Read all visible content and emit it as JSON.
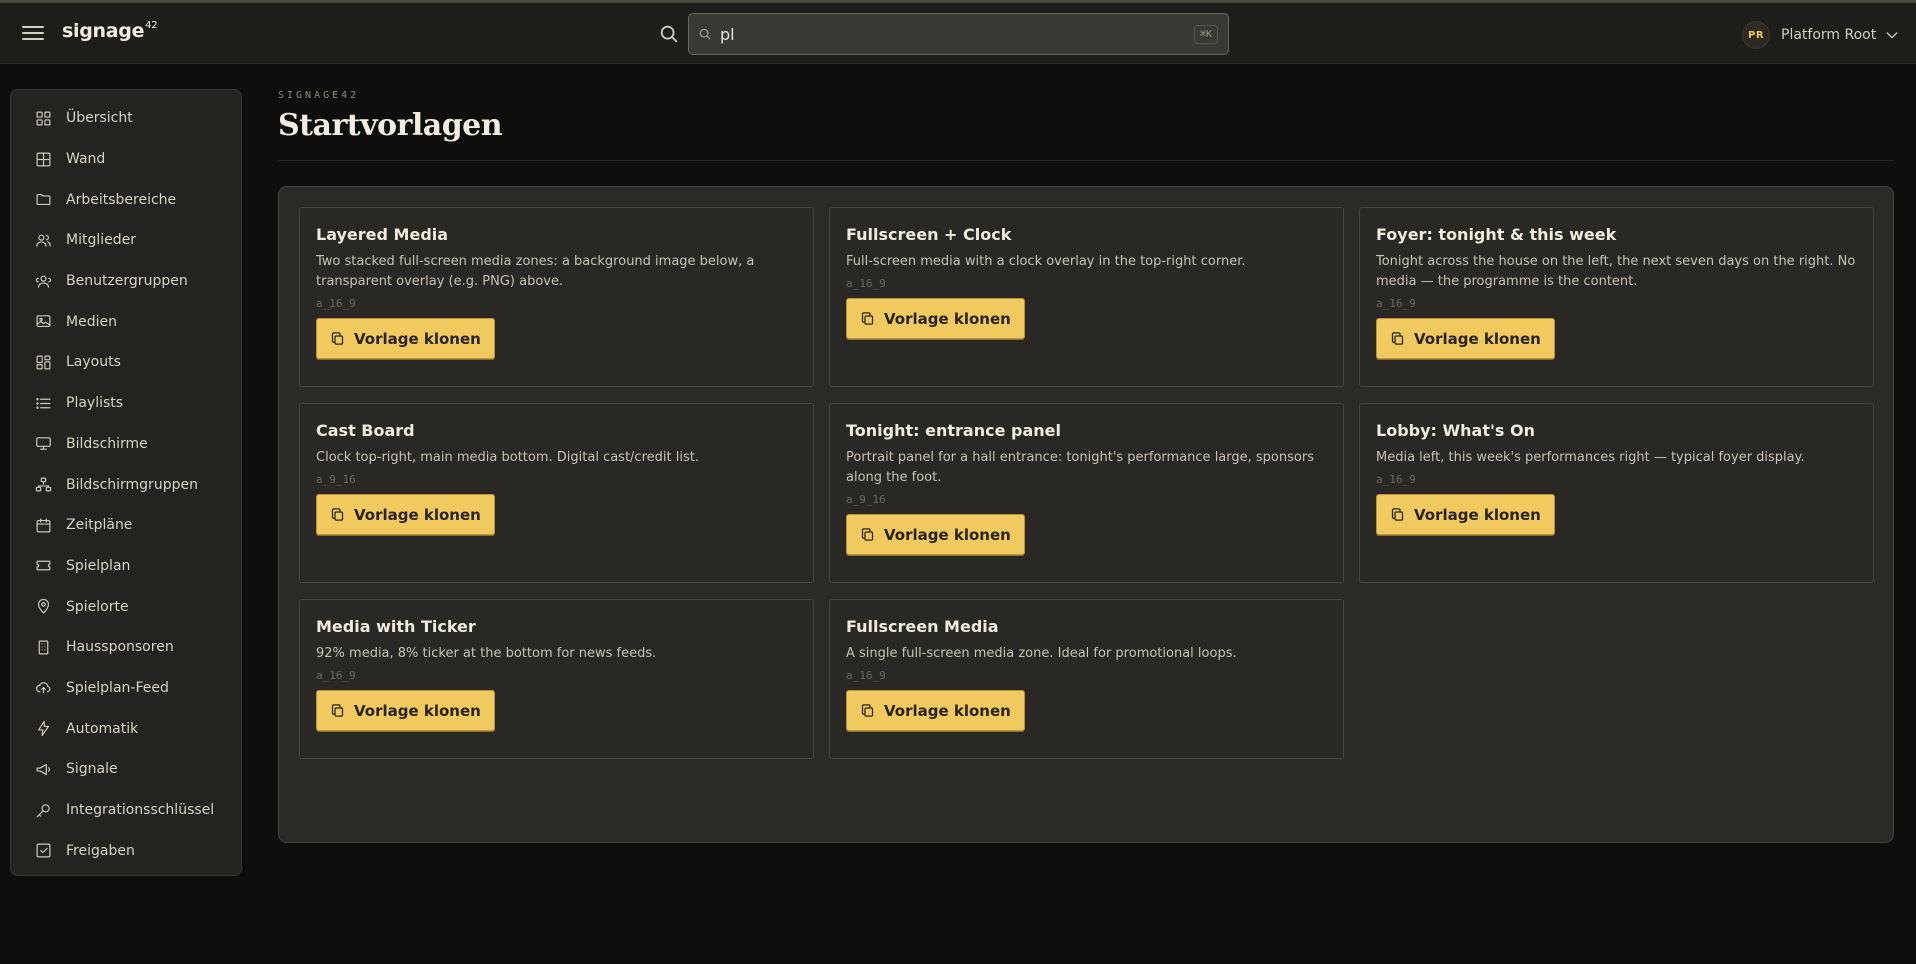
{
  "app": {
    "brand": "signage",
    "brand_sup": "42"
  },
  "search": {
    "value": "pl",
    "shortcut": "⌘K"
  },
  "user": {
    "initials": "PR",
    "name": "Platform Root"
  },
  "nav": [
    {
      "label": "Übersicht",
      "icon": "grid-icon"
    },
    {
      "label": "Wand",
      "icon": "table-icon"
    },
    {
      "label": "Arbeitsbereiche",
      "icon": "folder-icon"
    },
    {
      "label": "Mitglieder",
      "icon": "users-icon"
    },
    {
      "label": "Benutzergruppen",
      "icon": "user-group-icon"
    },
    {
      "label": "Medien",
      "icon": "images-icon"
    },
    {
      "label": "Layouts",
      "icon": "layout-icon"
    },
    {
      "label": "Playlists",
      "icon": "list-icon"
    },
    {
      "label": "Bildschirme",
      "icon": "monitor-icon"
    },
    {
      "label": "Bildschirmgruppen",
      "icon": "network-icon"
    },
    {
      "label": "Zeitpläne",
      "icon": "calendar-icon"
    },
    {
      "label": "Spielplan",
      "icon": "ticket-icon"
    },
    {
      "label": "Spielorte",
      "icon": "map-pin-icon"
    },
    {
      "label": "Haussponsoren",
      "icon": "building-icon"
    },
    {
      "label": "Spielplan-Feed",
      "icon": "cloud-upload-icon"
    },
    {
      "label": "Automatik",
      "icon": "lightning-icon"
    },
    {
      "label": "Signale",
      "icon": "megaphone-icon"
    },
    {
      "label": "Integrationsschlüssel",
      "icon": "key-icon"
    },
    {
      "label": "Freigaben",
      "icon": "checkbox-icon"
    }
  ],
  "page": {
    "eyebrow": "SIGNAGE42",
    "title": "Startvorlagen"
  },
  "clone_label": "Vorlage klonen",
  "templates": [
    {
      "title": "Layered Media",
      "desc": "Two stacked full-screen media zones: a background image below, a transparent overlay (e.g. PNG) above.",
      "code": "a_16_9"
    },
    {
      "title": "Fullscreen + Clock",
      "desc": "Full-screen media with a clock overlay in the top-right corner.",
      "code": "a_16_9"
    },
    {
      "title": "Foyer: tonight & this week",
      "desc": "Tonight across the house on the left, the next seven days on the right. No media — the programme is the content.",
      "code": "a_16_9"
    },
    {
      "title": "Cast Board",
      "desc": "Clock top-right, main media bottom. Digital cast/credit list.",
      "code": "a_9_16"
    },
    {
      "title": "Tonight: entrance panel",
      "desc": "Portrait panel for a hall entrance: tonight's performance large, sponsors along the foot.",
      "code": "a_9_16"
    },
    {
      "title": "Lobby: What's On",
      "desc": "Media left, this week's performances right — typical foyer display.",
      "code": "a_16_9"
    },
    {
      "title": "Media with Ticker",
      "desc": "92% media, 8% ticker at the bottom for news feeds.",
      "code": "a_16_9"
    },
    {
      "title": "Fullscreen Media",
      "desc": "A single full-screen media zone. Ideal for promotional loops.",
      "code": "a_16_9"
    }
  ]
}
